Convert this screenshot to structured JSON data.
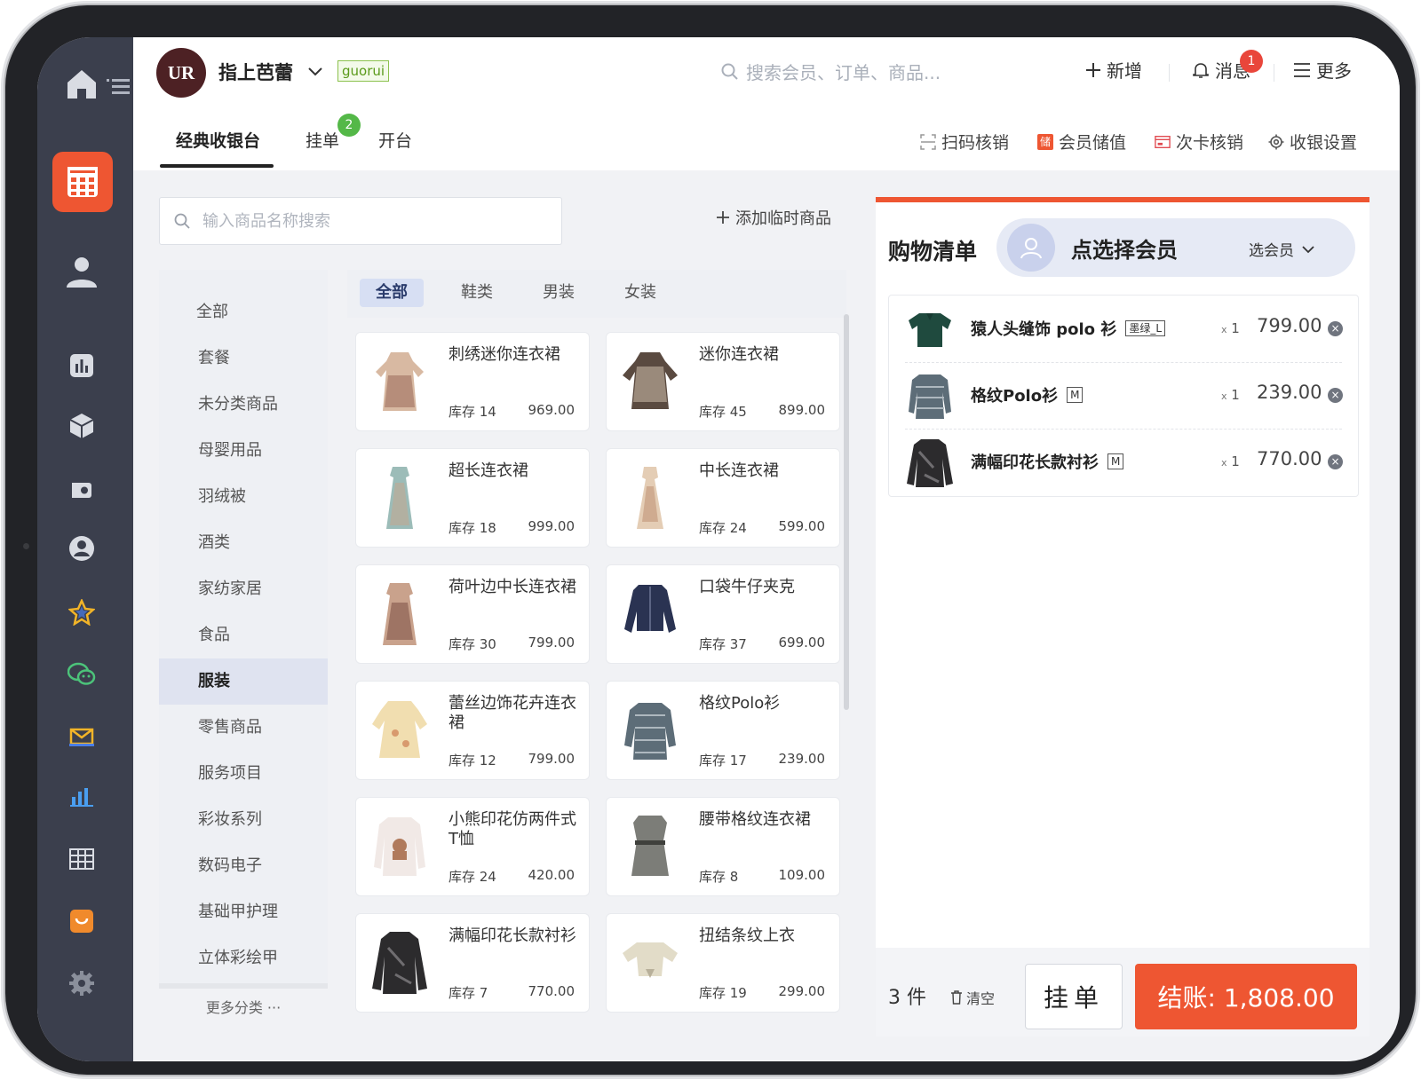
{
  "header": {
    "logo_text": "UR",
    "store_name": "指上芭蕾",
    "store_tag": "guorui",
    "search_placeholder": "搜索会员、订单、商品...",
    "new_label": "新增",
    "message_label": "消息",
    "message_badge": "1",
    "more_label": "更多"
  },
  "tabs": {
    "classic": "经典收银台",
    "pending": "挂单",
    "pending_badge": "2",
    "open_table": "开台"
  },
  "tools": {
    "scan": "扫码核销",
    "recharge_icon": "储",
    "recharge": "会员储值",
    "card": "次卡核销",
    "settings": "收银设置"
  },
  "product_search": {
    "placeholder": "输入商品名称搜索",
    "add_temp": "添加临时商品"
  },
  "categories": [
    "全部",
    "套餐",
    "未分类商品",
    "母婴用品",
    "羽绒被",
    "酒类",
    "家纺家居",
    "食品",
    "服装",
    "零售商品",
    "服务项目",
    "彩妆系列",
    "数码电子",
    "基础甲护理",
    "立体彩绘甲"
  ],
  "active_category": "服装",
  "more_categories": "更多分类 ···",
  "subtabs": [
    "全部",
    "鞋类",
    "男装",
    "女装"
  ],
  "products": [
    {
      "name": "刺绣迷你连衣裙",
      "stock": "库存 14",
      "price": "969.00"
    },
    {
      "name": "迷你连衣裙",
      "stock": "库存 45",
      "price": "899.00"
    },
    {
      "name": "超长连衣裙",
      "stock": "库存 18",
      "price": "999.00"
    },
    {
      "name": "中长连衣裙",
      "stock": "库存 24",
      "price": "599.00"
    },
    {
      "name": "荷叶边中长连衣裙",
      "stock": "库存 30",
      "price": "799.00"
    },
    {
      "name": "口袋牛仔夹克",
      "stock": "库存 37",
      "price": "699.00"
    },
    {
      "name": "蕾丝边饰花卉连衣裙",
      "stock": "库存 12",
      "price": "799.00"
    },
    {
      "name": "格纹Polo衫",
      "stock": "库存 17",
      "price": "239.00"
    },
    {
      "name": "小熊印花仿两件式T恤",
      "stock": "库存 24",
      "price": "420.00"
    },
    {
      "name": "腰带格纹连衣裙",
      "stock": "库存 8",
      "price": "109.00"
    },
    {
      "name": "满幅印花长款衬衫",
      "stock": "库存 7",
      "price": "770.00"
    },
    {
      "name": "扭结条纹上衣",
      "stock": "库存 19",
      "price": "299.00"
    }
  ],
  "cart": {
    "title": "购物清单",
    "member_text": "点选择会员",
    "member_select": "选会员",
    "items": [
      {
        "name": "猿人头缝饰 polo 衫",
        "size": "墨绿_L",
        "qty_x": "x",
        "qty": "1",
        "price": "799.00"
      },
      {
        "name": "格纹Polo衫",
        "size": "M",
        "qty_x": "x",
        "qty": "1",
        "price": "239.00"
      },
      {
        "name": "满幅印花长款衬衫",
        "size": "M",
        "qty_x": "x",
        "qty": "1",
        "price": "770.00"
      }
    ],
    "count": "3 件",
    "clear": "清空",
    "hold": "挂单",
    "checkout": "结账: 1,808.00"
  },
  "colors": {
    "accent": "#ee5632",
    "sidebar": "#3b3f4d",
    "badge_green": "#54b848",
    "badge_red": "#e9463b"
  }
}
